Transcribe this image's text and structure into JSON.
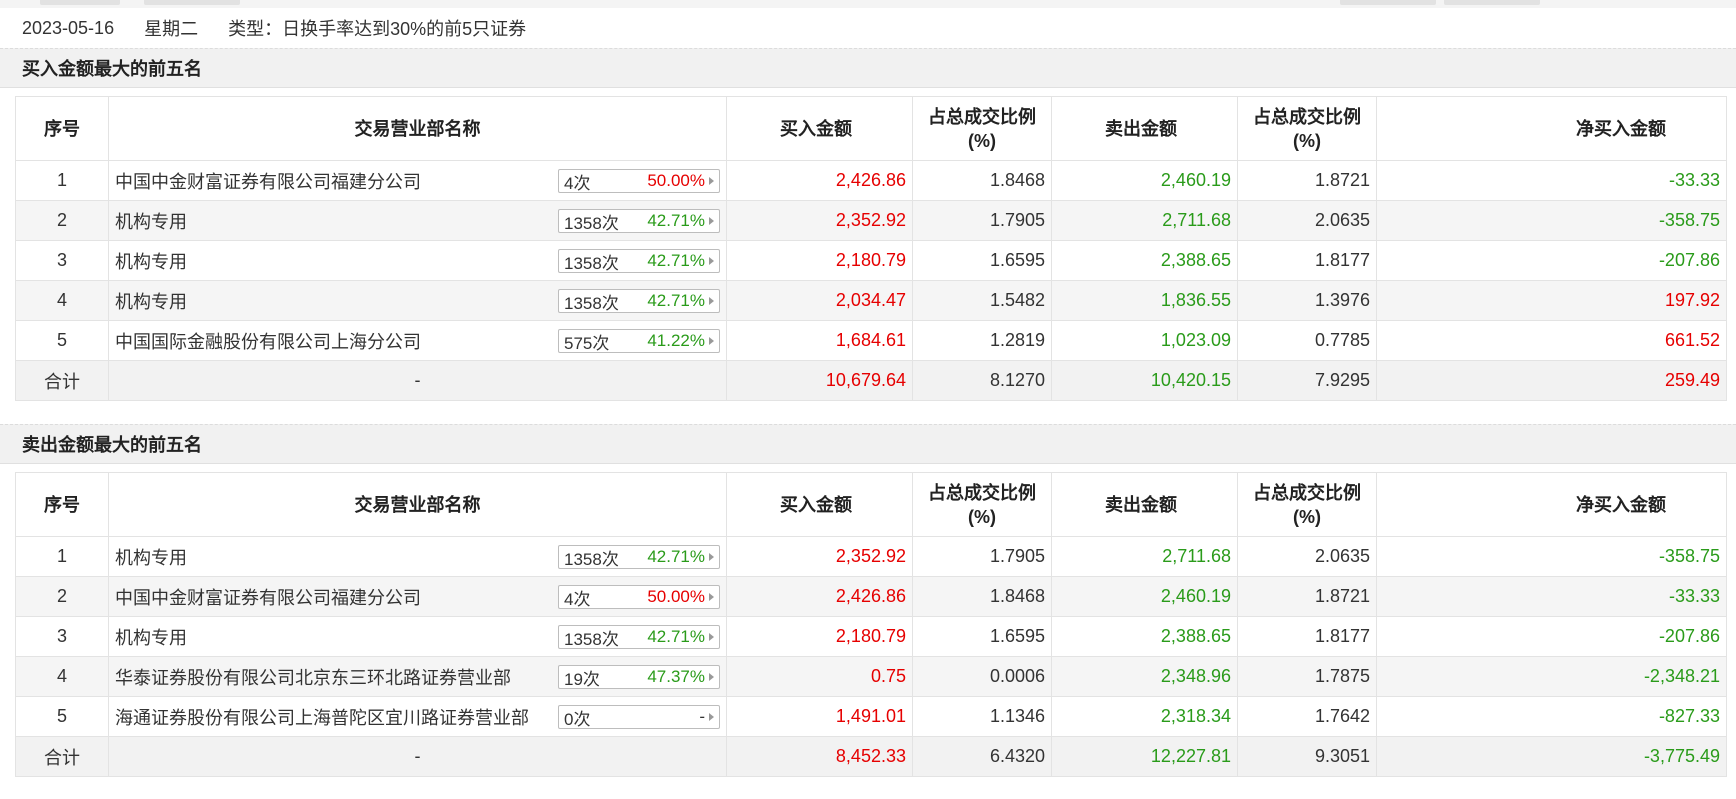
{
  "info": {
    "date": "2023-05-16",
    "weekday": "星期二",
    "type_text": "类型：日换手率达到30%的前5只证券"
  },
  "columns": {
    "idx": "序号",
    "name": "交易营业部名称",
    "buy": "买入金额",
    "buy_ratio_l1": "占总成交比例",
    "buy_ratio_l2": "(%)",
    "sell": "卖出金额",
    "sell_ratio_l1": "占总成交比例",
    "sell_ratio_l2": "(%)",
    "net": "净买入金额"
  },
  "colors": {
    "up": "#e60000",
    "down": "#2a9b1a"
  },
  "buy_section": {
    "title": "买入金额最大的前五名",
    "rows": [
      {
        "idx": "1",
        "name": "中国中金财富证券有限公司福建分公司",
        "count": "4次",
        "pct": "50.00%",
        "buy": "2,426.86",
        "buy_ratio": "1.8468",
        "sell": "2,460.19",
        "sell_ratio": "1.8721",
        "net": "-33.33"
      },
      {
        "idx": "2",
        "name": "机构专用",
        "count": "1358次",
        "pct": "42.71%",
        "buy": "2,352.92",
        "buy_ratio": "1.7905",
        "sell": "2,711.68",
        "sell_ratio": "2.0635",
        "net": "-358.75"
      },
      {
        "idx": "3",
        "name": "机构专用",
        "count": "1358次",
        "pct": "42.71%",
        "buy": "2,180.79",
        "buy_ratio": "1.6595",
        "sell": "2,388.65",
        "sell_ratio": "1.8177",
        "net": "-207.86"
      },
      {
        "idx": "4",
        "name": "机构专用",
        "count": "1358次",
        "pct": "42.71%",
        "buy": "2,034.47",
        "buy_ratio": "1.5482",
        "sell": "1,836.55",
        "sell_ratio": "1.3976",
        "net": "197.92"
      },
      {
        "idx": "5",
        "name": "中国国际金融股份有限公司上海分公司",
        "count": "575次",
        "pct": "41.22%",
        "buy": "1,684.61",
        "buy_ratio": "1.2819",
        "sell": "1,023.09",
        "sell_ratio": "0.7785",
        "net": "661.52"
      }
    ],
    "total": {
      "label": "合计",
      "name": "-",
      "buy": "10,679.64",
      "buy_ratio": "8.1270",
      "sell": "10,420.15",
      "sell_ratio": "7.9295",
      "net": "259.49"
    }
  },
  "sell_section": {
    "title": "卖出金额最大的前五名",
    "rows": [
      {
        "idx": "1",
        "name": "机构专用",
        "count": "1358次",
        "pct": "42.71%",
        "buy": "2,352.92",
        "buy_ratio": "1.7905",
        "sell": "2,711.68",
        "sell_ratio": "2.0635",
        "net": "-358.75"
      },
      {
        "idx": "2",
        "name": "中国中金财富证券有限公司福建分公司",
        "count": "4次",
        "pct": "50.00%",
        "buy": "2,426.86",
        "buy_ratio": "1.8468",
        "sell": "2,460.19",
        "sell_ratio": "1.8721",
        "net": "-33.33"
      },
      {
        "idx": "3",
        "name": "机构专用",
        "count": "1358次",
        "pct": "42.71%",
        "buy": "2,180.79",
        "buy_ratio": "1.6595",
        "sell": "2,388.65",
        "sell_ratio": "1.8177",
        "net": "-207.86"
      },
      {
        "idx": "4",
        "name": "华泰证券股份有限公司北京东三环北路证券营业部",
        "count": "19次",
        "pct": "47.37%",
        "buy": "0.75",
        "buy_ratio": "0.0006",
        "sell": "2,348.96",
        "sell_ratio": "1.7875",
        "net": "-2,348.21"
      },
      {
        "idx": "5",
        "name": "海通证券股份有限公司上海普陀区宜川路证券营业部",
        "count": "0次",
        "pct": "-",
        "buy": "1,491.01",
        "buy_ratio": "1.1346",
        "sell": "2,318.34",
        "sell_ratio": "1.7642",
        "net": "-827.33"
      }
    ],
    "total": {
      "label": "合计",
      "name": "-",
      "buy": "8,452.33",
      "buy_ratio": "6.4320",
      "sell": "12,227.81",
      "sell_ratio": "9.3051",
      "net": "-3,775.49"
    }
  }
}
